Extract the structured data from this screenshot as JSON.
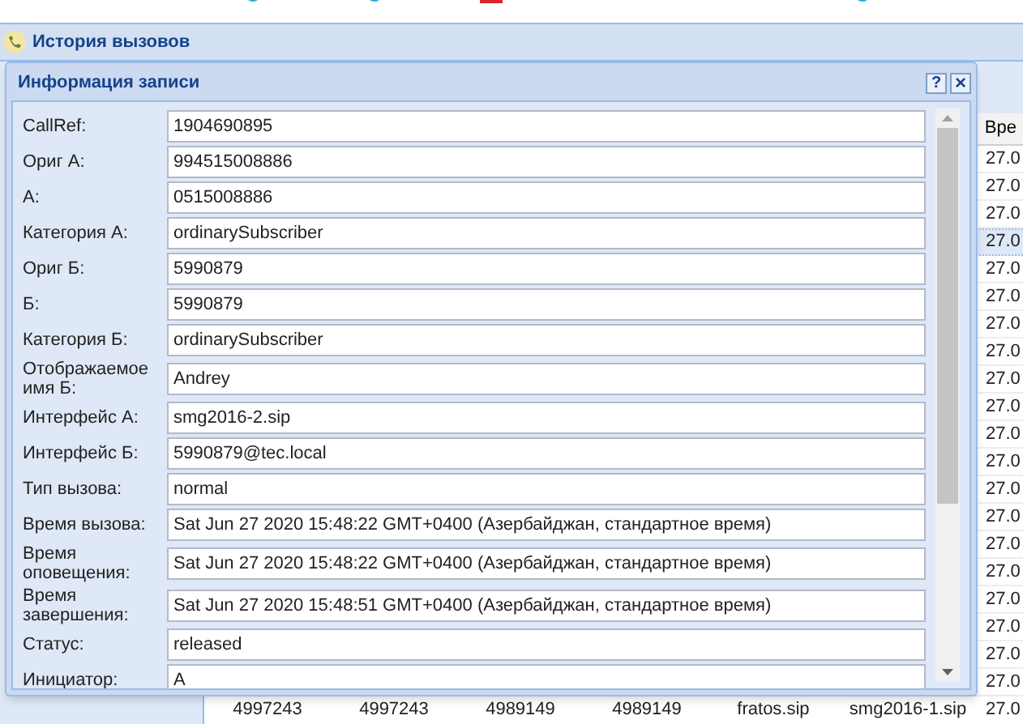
{
  "panel": {
    "title": "История вызовов"
  },
  "grid": {
    "column_header": "Вре",
    "rows": [
      {
        "cells": [
          "27.0"
        ],
        "selected": false
      },
      {
        "cells": [
          "27.0"
        ],
        "selected": false
      },
      {
        "cells": [
          "27.0"
        ],
        "selected": false
      },
      {
        "cells": [
          "27.0"
        ],
        "selected": true
      },
      {
        "cells": [
          "27.0"
        ],
        "selected": false
      },
      {
        "cells": [
          "27.0"
        ],
        "selected": false
      },
      {
        "cells": [
          "27.0"
        ],
        "selected": false
      },
      {
        "cells": [
          "27.0"
        ],
        "selected": false
      },
      {
        "cells": [
          "27.0"
        ],
        "selected": false
      },
      {
        "cells": [
          "27.0"
        ],
        "selected": false
      },
      {
        "cells": [
          "27.0"
        ],
        "selected": false
      },
      {
        "cells": [
          "27.0"
        ],
        "selected": false
      },
      {
        "cells": [
          "27.0"
        ],
        "selected": false
      },
      {
        "cells": [
          "27.0"
        ],
        "selected": false
      },
      {
        "cells": [
          "27.0"
        ],
        "selected": false
      },
      {
        "cells": [
          "27.0"
        ],
        "selected": false
      },
      {
        "cells": [
          "27.0"
        ],
        "selected": false
      },
      {
        "cells": [
          "27.0"
        ],
        "selected": false
      },
      {
        "cells": [
          "27.0"
        ],
        "selected": false
      },
      {
        "cells": [
          "27.0"
        ],
        "selected": false
      }
    ],
    "bottom_row": [
      "4997243",
      "4997243",
      "4989149",
      "4989149",
      "fratos.sip",
      "smg2016-1.sip",
      "27.0"
    ]
  },
  "dialog": {
    "title": "Информация записи",
    "help_button": "?",
    "close_button": "×",
    "fields": [
      {
        "label": "CallRef:",
        "value": "1904690895"
      },
      {
        "label": "Ориг А:",
        "value": "994515008886"
      },
      {
        "label": "А:",
        "value": "0515008886"
      },
      {
        "label": "Категория А:",
        "value": "ordinarySubscriber"
      },
      {
        "label": "Ориг Б:",
        "value": "5990879"
      },
      {
        "label": "Б:",
        "value": "5990879"
      },
      {
        "label": "Категория Б:",
        "value": "ordinarySubscriber"
      },
      {
        "label": "Отображаемое имя Б:",
        "value": "Andrey"
      },
      {
        "label": "Интерфейс А:",
        "value": "smg2016-2.sip"
      },
      {
        "label": "Интерфейс Б:",
        "value": "5990879@tec.local"
      },
      {
        "label": "Тип вызова:",
        "value": "normal"
      },
      {
        "label": "Время вызова:",
        "value": "Sat Jun 27 2020 15:48:22 GMT+0400 (Азербайджан, стандартное время)"
      },
      {
        "label": "Время оповещения:",
        "value": "Sat Jun 27 2020 15:48:22 GMT+0400 (Азербайджан, стандартное время)"
      },
      {
        "label": "Время завершения:",
        "value": "Sat Jun 27 2020 15:48:51 GMT+0400 (Азербайджан, стандартное время)"
      },
      {
        "label": "Статус:",
        "value": "released"
      },
      {
        "label": "Инициатор:",
        "value": "A"
      }
    ]
  }
}
